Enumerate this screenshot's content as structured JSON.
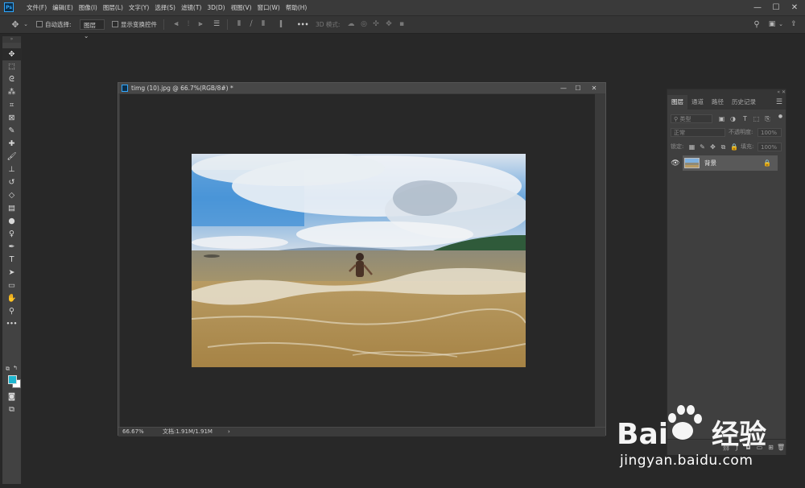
{
  "menubar": {
    "logo": "Ps",
    "items": [
      "文件(F)",
      "编辑(E)",
      "图像(I)",
      "图层(L)",
      "文字(Y)",
      "选择(S)",
      "滤镜(T)",
      "3D(D)",
      "视图(V)",
      "窗口(W)",
      "帮助(H)"
    ],
    "controls": {
      "minimize": "—",
      "maximize": "☐",
      "close": "✕"
    }
  },
  "options": {
    "move_icon": "move-icon",
    "auto_select_label": "自动选择:",
    "auto_select_value": "图层",
    "show_transform_label": "显示变换控件",
    "more": "•••",
    "mode_3d_label": "3D 模式:"
  },
  "tools": {
    "items": [
      {
        "name": "move-tool-icon",
        "glyph": "✥"
      },
      {
        "name": "marquee-tool-icon",
        "glyph": "⬚"
      },
      {
        "name": "lasso-tool-icon",
        "glyph": "ᘓ"
      },
      {
        "name": "quick-select-tool-icon",
        "glyph": "⁂"
      },
      {
        "name": "crop-tool-icon",
        "glyph": "⌗"
      },
      {
        "name": "frame-tool-icon",
        "glyph": "⊠"
      },
      {
        "name": "eyedropper-tool-icon",
        "glyph": "✎"
      },
      {
        "name": "healing-brush-tool-icon",
        "glyph": "✚"
      },
      {
        "name": "brush-tool-icon",
        "glyph": "🖌"
      },
      {
        "name": "clone-stamp-tool-icon",
        "glyph": "⊥"
      },
      {
        "name": "history-brush-tool-icon",
        "glyph": "↺"
      },
      {
        "name": "eraser-tool-icon",
        "glyph": "◇"
      },
      {
        "name": "gradient-tool-icon",
        "glyph": "▤"
      },
      {
        "name": "blur-tool-icon",
        "glyph": "●"
      },
      {
        "name": "dodge-tool-icon",
        "glyph": "♀"
      },
      {
        "name": "pen-tool-icon",
        "glyph": "✒"
      },
      {
        "name": "type-tool-icon",
        "glyph": "T"
      },
      {
        "name": "path-select-tool-icon",
        "glyph": "➤"
      },
      {
        "name": "rectangle-tool-icon",
        "glyph": "▭"
      },
      {
        "name": "hand-tool-icon",
        "glyph": "✋"
      },
      {
        "name": "zoom-tool-icon",
        "glyph": "⚲"
      },
      {
        "name": "more-tools-icon",
        "glyph": "•••"
      }
    ],
    "foreground_color": "#1fb6cf",
    "background_color": "#ffffff"
  },
  "document": {
    "title": "timg (10).jpg @ 66.7%(RGB/8#) *",
    "zoom": "66.67%",
    "doc_info": "文档:1.91M/1.91M",
    "status_arrow": "›"
  },
  "layers_panel": {
    "tabs": [
      "图层",
      "通道",
      "路径",
      "历史记录"
    ],
    "kind_placeholder": "类型",
    "blend_mode": "正常",
    "opacity_label": "不透明度:",
    "opacity_value": "100%",
    "lock_label": "锁定:",
    "fill_label": "填充:",
    "fill_value": "100%",
    "layer_name": "背景"
  },
  "watermark": {
    "text": "jingyan.baidu.com"
  }
}
